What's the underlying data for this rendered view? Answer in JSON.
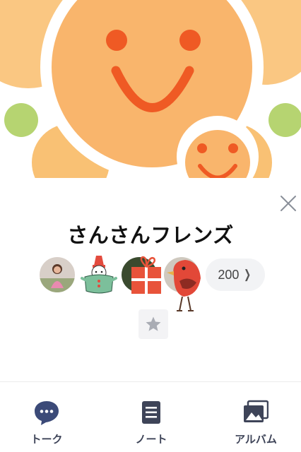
{
  "group": {
    "name": "さんさんフレンズ",
    "member_count": "200"
  },
  "tabs": [
    {
      "label": "トーク",
      "icon": "chat-bubble-icon"
    },
    {
      "label": "ノート",
      "icon": "note-icon"
    },
    {
      "label": "アルバム",
      "icon": "album-icon"
    }
  ],
  "icons": {
    "close": "close-icon",
    "favorite": "star-icon",
    "member_count_chevron": "chevron-right-icon"
  },
  "colors": {
    "cover_orange": "#f7a960",
    "cover_face": "#f9b168",
    "cover_eye": "#ef5a24",
    "cover_green": "#b6d471",
    "tab_icon": "#3e4458",
    "chat_icon": "#3b4a78"
  }
}
